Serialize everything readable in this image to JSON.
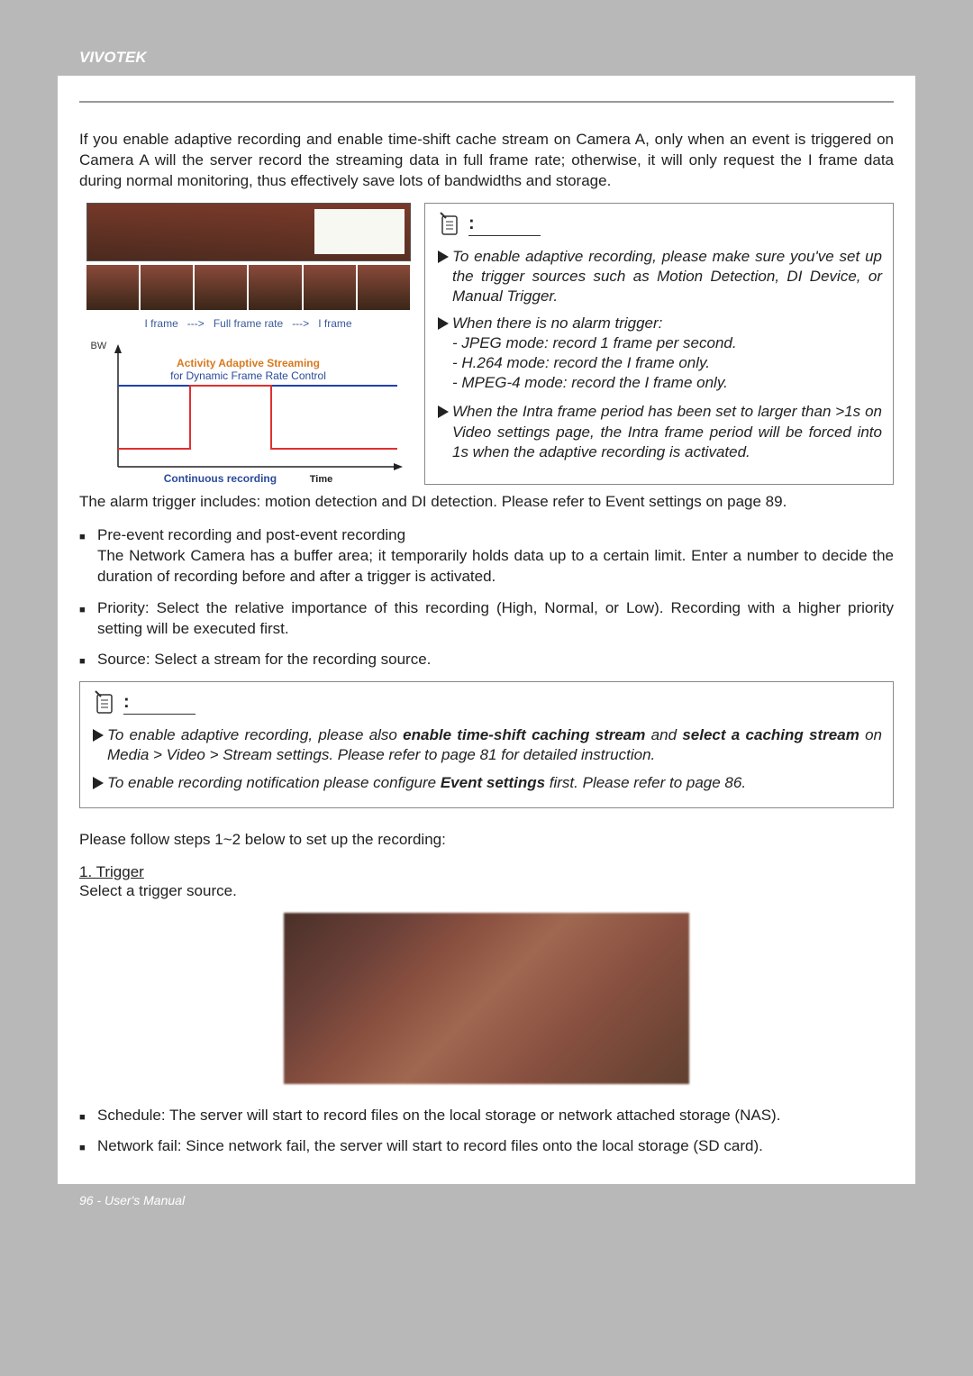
{
  "header": {
    "brand": "VIVOTEK"
  },
  "intro": "If you enable adaptive recording and enable time-shift cache stream on Camera A, only when an event is triggered on Camera A will the server record the streaming data in full frame rate; otherwise, it will only request the I frame data during normal monitoring, thus effectively save lots of bandwidths and storage.",
  "diagram": {
    "frameline_a": "I frame",
    "frameline_arrow": "--->",
    "frameline_b": "Full frame rate",
    "frameline_c": "I frame",
    "y_label": "BW",
    "aas_title": "Activity Adaptive Streaming",
    "aas_sub": "for Dynamic Frame Rate Control",
    "cont_rec": "Continuous recording",
    "time_lbl": "Time"
  },
  "notebox1": {
    "label": "NOTE",
    "l1": "To enable adaptive recording, please make sure you've set up the trigger sources such as Motion Detection, DI Device, or Manual Trigger.",
    "l2": "When there is no alarm trigger:",
    "l2a": "- JPEG mode: record 1 frame per second.",
    "l2b": "- H.264 mode: record the I frame only.",
    "l2c": "- MPEG-4 mode: record the I frame only.",
    "l3": "When the Intra frame period has been set to larger than >1s on Video settings page, the Intra frame period will be forced into 1s when the adaptive recording is activated."
  },
  "after_box": "The alarm trigger includes: motion detection and DI detection. Please refer to Event settings on page 89.",
  "bullets1": {
    "b1_head": "Pre-event recording and post-event recording",
    "b1_body": "The Network Camera has a buffer area; it temporarily holds data up to a certain limit. Enter a number to decide the duration of recording before and after a trigger is activated.",
    "b2": "Priority: Select the relative importance of this recording (High, Normal, or Low). Recording with a higher priority setting will be executed first.",
    "b3": "Source: Select a stream for the recording source."
  },
  "notebox2": {
    "l1a": "To enable adaptive recording, please also ",
    "l1_bold1": "enable time-shift caching stream",
    "l1b": " and ",
    "l1_bold2": "select a caching stream",
    "l1c": " on Media > Video > Stream settings. Please refer to page 81 for detailed instruction.",
    "l2a": "To enable recording notification please configure ",
    "l2_bold": "Event settings",
    "l2b": " first. Please refer to page 86."
  },
  "steps_intro": "Please follow steps 1~2 below to set up the recording:",
  "step1": {
    "heading": "1. Trigger",
    "sub": " Select a trigger source."
  },
  "bullets2": {
    "b1": "Schedule: The server will start to record files on the local storage or network attached storage (NAS).",
    "b2": "Network fail: Since network fail, the server will start to record files onto the local storage (SD card)."
  },
  "footer": {
    "text": "96 - User's Manual"
  },
  "chart_data": {
    "type": "line",
    "title": "Activity Adaptive Streaming for Dynamic Frame Rate Control",
    "xlabel": "Time",
    "ylabel": "BW",
    "series": [
      {
        "name": "Activity Adaptive Streaming",
        "color": "#e03030",
        "x": [
          0,
          2,
          2,
          5,
          5,
          10
        ],
        "y": [
          2,
          2,
          9,
          9,
          2,
          2
        ]
      },
      {
        "name": "Continuous recording",
        "color": "#2040b0",
        "x": [
          0,
          10
        ],
        "y": [
          9,
          9
        ]
      }
    ],
    "xlim": [
      0,
      10
    ],
    "ylim": [
      0,
      10
    ]
  }
}
